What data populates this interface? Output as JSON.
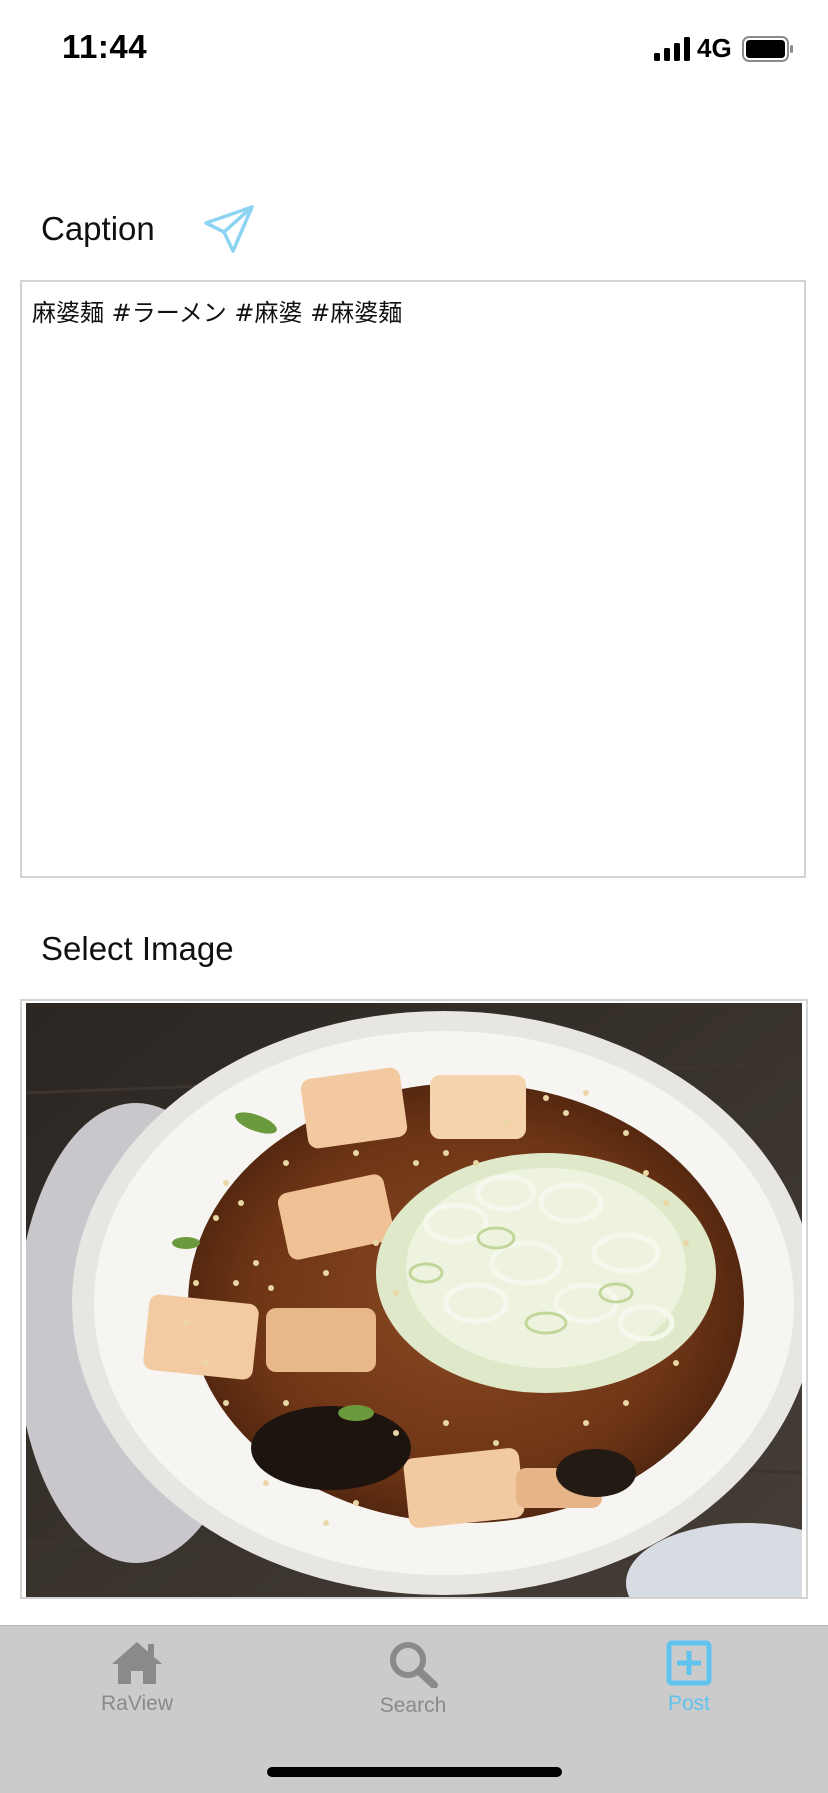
{
  "status_bar": {
    "time": "11:44",
    "network": "4G",
    "icons": [
      "signal-icon",
      "battery-icon"
    ]
  },
  "caption": {
    "label": "Caption",
    "send_icon": "paper-plane-icon",
    "text": "麻婆麺 #ラーメン #麻婆 #麻婆麺"
  },
  "image_section": {
    "label": "Select Image",
    "image": "photo of mapo ramen bowl"
  },
  "tab_bar": {
    "tabs": [
      {
        "label": "RaView",
        "icon": "home-icon",
        "active": false
      },
      {
        "label": "Search",
        "icon": "search-icon",
        "active": false
      },
      {
        "label": "Post",
        "icon": "plus-square-icon",
        "active": true
      }
    ]
  },
  "colors": {
    "accent": "#5fc3ee",
    "inactive": "#8a8a8a",
    "tab_bar_bg": "#cbcbcb",
    "border": "#d3d3d3"
  }
}
